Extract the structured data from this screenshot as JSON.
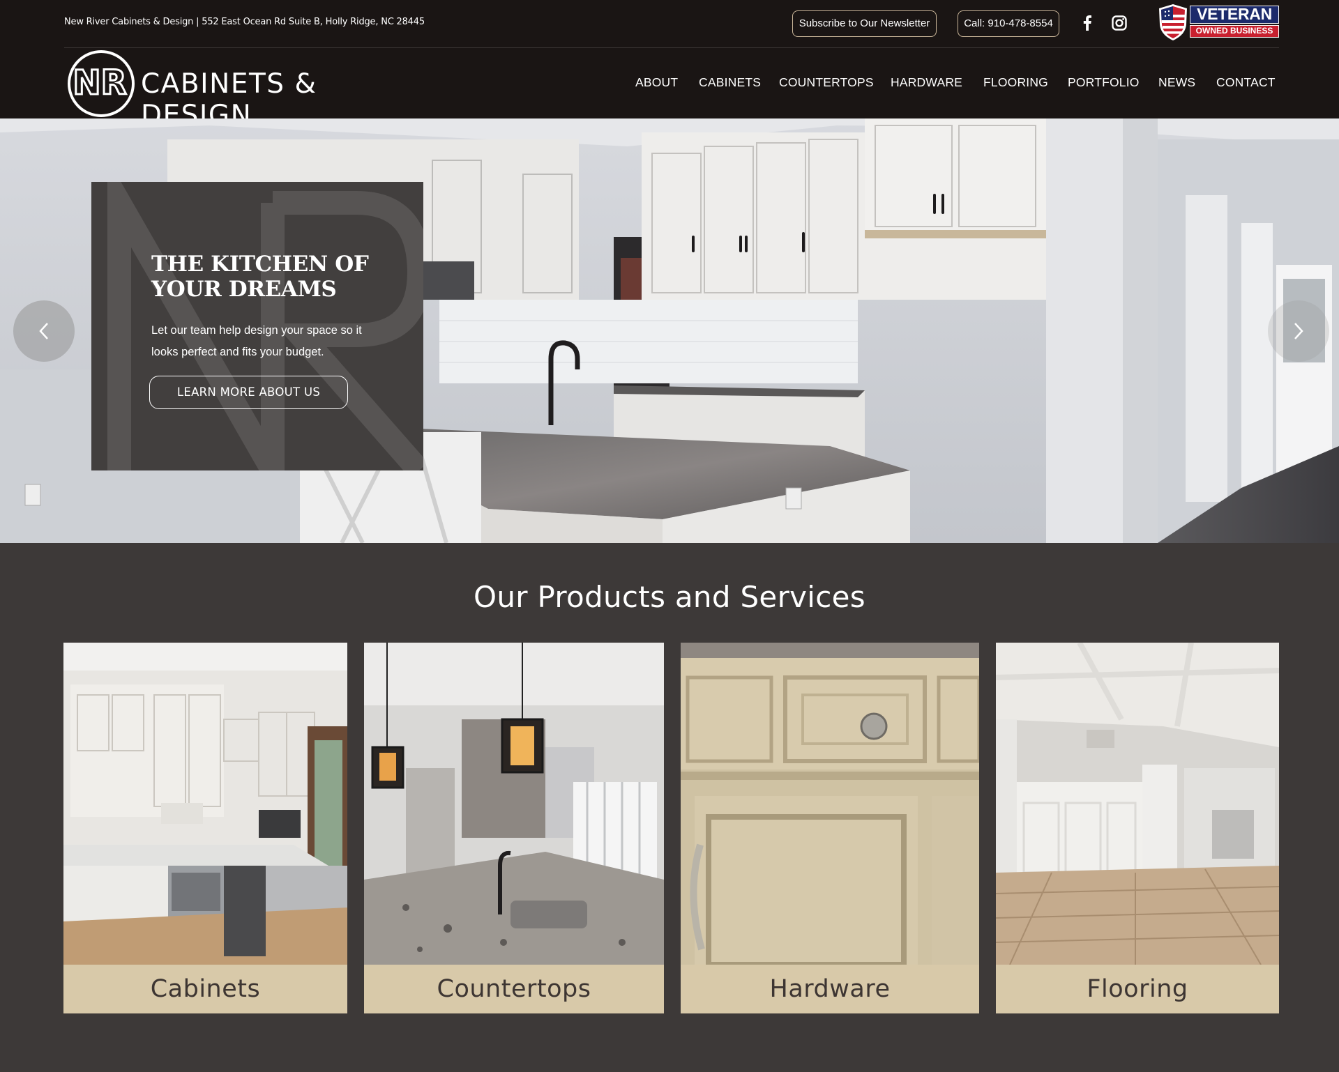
{
  "topbar": {
    "address": "New River Cabinets & Design | 552 East Ocean Rd Suite B, Holly Ridge, NC 28445",
    "newsletter_label": "Subscribe to Our Newsletter",
    "call_label": "Call: 910-478-8554",
    "social": [
      "facebook-icon",
      "instagram-icon"
    ],
    "badge": {
      "word": "VETERAN",
      "sub": "OWNED BUSINESS"
    }
  },
  "header": {
    "logo_mark": "NR",
    "logo_text": "CABINETS & DESIGN",
    "nav": [
      "ABOUT",
      "CABINETS",
      "COUNTERTOPS",
      "HARDWARE",
      "FLOORING",
      "PORTFOLIO",
      "NEWS",
      "CONTACT"
    ]
  },
  "hero": {
    "title": "THE KITCHEN OF YOUR DREAMS",
    "text": "Let our team help design your space so it looks perfect and fits your budget.",
    "button_label": "LEARN MORE ABOUT US",
    "prev_icon": "chevron-left-icon",
    "next_icon": "chevron-right-icon"
  },
  "products": {
    "title": "Our Products and Services",
    "items": [
      {
        "label": "Cabinets"
      },
      {
        "label": "Countertops"
      },
      {
        "label": "Hardware"
      },
      {
        "label": "Flooring"
      }
    ]
  },
  "colors": {
    "header_bg": "#1a1514",
    "page_bg": "#3d3938",
    "card_label_bg": "#d8c9a9",
    "accent_border": "#cbb79a",
    "badge_blue": "#1c2a6b",
    "badge_red": "#c8202f"
  }
}
